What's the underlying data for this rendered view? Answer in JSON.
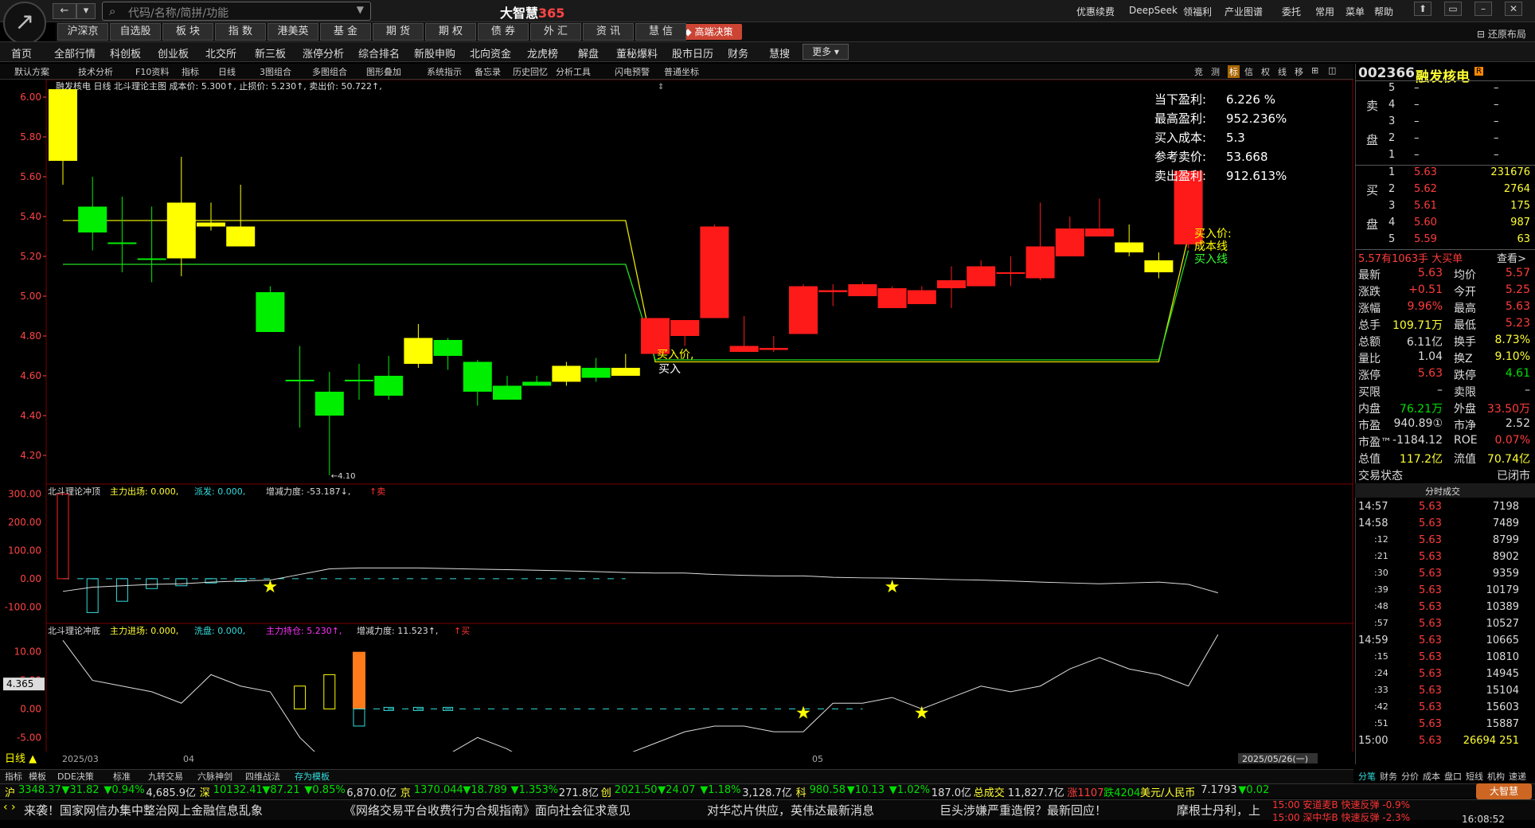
{
  "app": {
    "title": "大智慧",
    "title_suffix": "365"
  },
  "search": {
    "placeholder": "代码/名称/简拼/功能"
  },
  "title_menu": [
    "优惠续费",
    "DeepSeek",
    "领福利",
    "产业图谱",
    "委托",
    "常用",
    "菜单",
    "帮助"
  ],
  "window_buttons": [
    "⬆",
    "▭",
    "–",
    "✕"
  ],
  "restore_layout": "还原布局",
  "market_tabs": [
    "沪深京",
    "自选股",
    "板 块",
    "指 数",
    "港美英",
    "基 金",
    "期 货",
    "期 权",
    "债 券",
    "外 汇",
    "资 讯",
    "慧 信"
  ],
  "premium_button": "高端决策",
  "nav_items": [
    "首页",
    "全部行情",
    "科创板",
    "创业板",
    "北交所",
    "新三板",
    "涨停分析",
    "综合排名",
    "新股申购",
    "北向资金",
    "龙虎榜",
    "解盘",
    "董秘爆料",
    "股市日历",
    "财务",
    "慧搜"
  ],
  "more_button": "更多",
  "toolbar": [
    "默认方案",
    "技术分析",
    "F10资料",
    "指标",
    "日线",
    "3图组合",
    "多图组合",
    "图形叠加",
    "系统指示",
    "备忘录",
    "历史回忆",
    "分析工具",
    "闪电预警",
    "普通坐标"
  ],
  "toolbar_right": [
    "竞",
    "测",
    "标",
    "信",
    "权",
    "线",
    "移",
    "⊞",
    "◫"
  ],
  "main_chart": {
    "info_line": "融发核电 日线 北斗理论主图 成本价: 5.300↑, 止损价: 5.230↑, 卖出价: 50.722↑,",
    "top_label": "6.04",
    "low_label": "4.10",
    "y_ticks": [
      "6.00",
      "5.80",
      "5.60",
      "5.40",
      "5.20",
      "5.00",
      "4.80",
      "4.60",
      "4.40",
      "4.20"
    ],
    "buy_label_1": "买入价,",
    "buy_label_2": "买入",
    "right_labels": [
      "买入价:",
      "成本线",
      "买入线"
    ],
    "stats": [
      {
        "label": "当下盈利:",
        "value": "6.226  %"
      },
      {
        "label": "最高盈利:",
        "value": "952.236%"
      },
      {
        "label": "买入成本:",
        "value": "5.3"
      },
      {
        "label": "参考卖价:",
        "value": "53.668"
      },
      {
        "label": "卖出盈利:",
        "value": "912.613%"
      }
    ]
  },
  "chart_data": {
    "type": "candlestick",
    "ylim": [
      4.1,
      6.1
    ],
    "candles": [
      {
        "o": 6.04,
        "c": 5.68,
        "h": 6.04,
        "l": 5.56,
        "col": "y"
      },
      {
        "o": 5.45,
        "c": 5.32,
        "h": 5.6,
        "l": 5.23,
        "col": "g"
      },
      {
        "o": 5.27,
        "c": 5.27,
        "h": 5.5,
        "l": 5.12,
        "col": "g"
      },
      {
        "o": 5.19,
        "c": 5.19,
        "h": 5.45,
        "l": 5.07,
        "col": "g"
      },
      {
        "o": 5.47,
        "c": 5.19,
        "h": 5.7,
        "l": 5.1,
        "col": "y"
      },
      {
        "o": 5.37,
        "c": 5.35,
        "h": 5.47,
        "l": 5.33,
        "col": "y"
      },
      {
        "o": 5.35,
        "c": 5.25,
        "h": 5.56,
        "l": 5.25,
        "col": "y"
      },
      {
        "o": 5.02,
        "c": 4.82,
        "h": 5.05,
        "l": 4.82,
        "col": "g"
      },
      {
        "o": 4.58,
        "c": 4.58,
        "h": 4.75,
        "l": 4.34,
        "col": "g"
      },
      {
        "o": 4.52,
        "c": 4.4,
        "h": 4.62,
        "l": 4.1,
        "col": "g"
      },
      {
        "o": 4.58,
        "c": 4.58,
        "h": 4.66,
        "l": 4.48,
        "col": "g"
      },
      {
        "o": 4.6,
        "c": 4.5,
        "h": 4.7,
        "l": 4.48,
        "col": "g"
      },
      {
        "o": 4.79,
        "c": 4.66,
        "h": 4.86,
        "l": 4.64,
        "col": "y"
      },
      {
        "o": 4.78,
        "c": 4.7,
        "h": 4.79,
        "l": 4.63,
        "col": "g"
      },
      {
        "o": 4.67,
        "c": 4.52,
        "h": 4.68,
        "l": 4.45,
        "col": "g"
      },
      {
        "o": 4.55,
        "c": 4.48,
        "h": 4.6,
        "l": 4.48,
        "col": "g"
      },
      {
        "o": 4.57,
        "c": 4.55,
        "h": 4.6,
        "l": 4.55,
        "col": "g"
      },
      {
        "o": 4.65,
        "c": 4.57,
        "h": 4.67,
        "l": 4.55,
        "col": "y"
      },
      {
        "o": 4.64,
        "c": 4.59,
        "h": 4.69,
        "l": 4.57,
        "col": "g"
      },
      {
        "o": 4.64,
        "c": 4.6,
        "h": 4.71,
        "l": 4.6,
        "col": "y"
      },
      {
        "o": 4.71,
        "c": 4.89,
        "h": 4.89,
        "l": 4.71,
        "col": "r"
      },
      {
        "o": 4.8,
        "c": 4.88,
        "h": 4.88,
        "l": 4.75,
        "col": "r"
      },
      {
        "o": 4.89,
        "c": 5.35,
        "h": 5.36,
        "l": 4.89,
        "col": "r"
      },
      {
        "o": 4.72,
        "c": 4.75,
        "h": 4.9,
        "l": 4.72,
        "col": "r"
      },
      {
        "o": 4.73,
        "c": 4.74,
        "h": 4.8,
        "l": 4.72,
        "col": "r"
      },
      {
        "o": 4.81,
        "c": 5.05,
        "h": 5.06,
        "l": 4.81,
        "col": "r"
      },
      {
        "o": 5.02,
        "c": 5.03,
        "h": 5.06,
        "l": 4.95,
        "col": "r"
      },
      {
        "o": 5.0,
        "c": 5.06,
        "h": 5.07,
        "l": 5.0,
        "col": "r"
      },
      {
        "o": 4.94,
        "c": 5.04,
        "h": 5.05,
        "l": 4.94,
        "col": "r"
      },
      {
        "o": 4.96,
        "c": 5.03,
        "h": 5.05,
        "l": 4.96,
        "col": "r"
      },
      {
        "o": 5.04,
        "c": 5.08,
        "h": 5.15,
        "l": 4.94,
        "col": "r"
      },
      {
        "o": 5.05,
        "c": 5.15,
        "h": 5.18,
        "l": 5.05,
        "col": "r"
      },
      {
        "o": 5.12,
        "c": 5.12,
        "h": 5.2,
        "l": 5.05,
        "col": "r"
      },
      {
        "o": 5.09,
        "c": 5.25,
        "h": 5.47,
        "l": 5.08,
        "col": "r"
      },
      {
        "o": 5.2,
        "c": 5.34,
        "h": 5.4,
        "l": 5.2,
        "col": "r"
      },
      {
        "o": 5.3,
        "c": 5.34,
        "h": 5.49,
        "l": 5.3,
        "col": "r"
      },
      {
        "o": 5.27,
        "c": 5.22,
        "h": 5.36,
        "l": 5.2,
        "col": "y"
      },
      {
        "o": 5.18,
        "c": 5.12,
        "h": 5.22,
        "l": 5.09,
        "col": "y"
      },
      {
        "o": 5.26,
        "c": 5.63,
        "h": 5.63,
        "l": 5.24,
        "col": "r"
      }
    ],
    "cost_line": [
      5.38,
      5.38,
      5.38,
      5.38,
      5.38,
      5.38,
      5.38,
      5.38,
      5.38,
      5.38,
      5.38,
      5.38,
      5.38,
      5.38,
      5.38,
      5.38,
      5.38,
      5.38,
      5.38,
      5.38,
      4.67,
      4.67,
      4.67,
      4.67,
      4.67,
      4.67,
      4.67,
      4.67,
      4.67,
      4.67,
      4.67,
      4.67,
      4.67,
      4.67,
      4.67,
      4.67,
      4.67,
      4.67,
      5.3
    ],
    "buy_line": [
      5.16,
      5.16,
      5.16,
      5.16,
      5.16,
      5.16,
      5.16,
      5.16,
      5.16,
      5.16,
      5.16,
      5.16,
      5.16,
      5.16,
      5.16,
      5.16,
      5.16,
      5.16,
      5.16,
      5.16,
      4.68,
      4.68,
      4.68,
      4.68,
      4.68,
      4.68,
      4.68,
      4.68,
      4.68,
      4.68,
      4.68,
      4.68,
      4.68,
      4.68,
      4.68,
      4.68,
      4.68,
      4.68,
      5.23
    ]
  },
  "sub1": {
    "title": "北斗理论冲顶",
    "params": [
      {
        "t": "主力出场: 0.000,",
        "c": "yel"
      },
      {
        "t": "派发: 0.000,",
        "c": "cyn"
      },
      {
        "t": "增减力度: -53.187↓,",
        "c": "wht"
      },
      {
        "t": "↑卖",
        "c": "red"
      }
    ],
    "y_ticks": [
      "300.00",
      "200.00",
      "100.00",
      "0.00",
      "-100.00"
    ],
    "ylim": [
      -150,
      330
    ],
    "line": [
      -45,
      -30,
      -25,
      -20,
      -18,
      -12,
      -8,
      -5,
      15,
      35,
      38,
      38,
      38,
      36,
      34,
      32,
      30,
      28,
      25,
      22,
      20,
      20,
      15,
      12,
      10,
      10,
      5,
      3,
      2,
      0,
      -3,
      -5,
      -8,
      -12,
      -15,
      -18,
      -15,
      -12,
      -20,
      -50
    ],
    "bars": [
      {
        "i": 0,
        "v": 300,
        "c": "r"
      },
      {
        "i": 1,
        "v": -120,
        "c": "c"
      },
      {
        "i": 2,
        "v": -80,
        "c": "c"
      },
      {
        "i": 3,
        "v": -35,
        "c": "c"
      },
      {
        "i": 4,
        "v": -25,
        "c": "c"
      },
      {
        "i": 5,
        "v": -15,
        "c": "c"
      },
      {
        "i": 6,
        "v": -10,
        "c": "c"
      }
    ],
    "dash_until": 19,
    "stars": [
      7,
      28
    ]
  },
  "sub2": {
    "title": "北斗理论冲底",
    "params": [
      {
        "t": "主力进场: 0.000,",
        "c": "yel"
      },
      {
        "t": "洗盘: 0.000,",
        "c": "cyn"
      },
      {
        "t": "主力持仓: 5.230↑,",
        "c": "mag"
      },
      {
        "t": "增减力度: 11.523↑,",
        "c": "wht"
      },
      {
        "t": "↑买",
        "c": "red"
      }
    ],
    "y_ticks": [
      "10.00",
      "5.00",
      "0.00",
      "-5.00"
    ],
    "cur_value": "4.365",
    "ylim": [
      -9,
      14
    ],
    "line": [
      12,
      5,
      4,
      3,
      1,
      6,
      4,
      3,
      -5,
      -10,
      -10.5,
      -10,
      -9,
      -8,
      -5,
      -7,
      -10,
      -9.5,
      -9,
      -8,
      -6,
      -4,
      -3,
      -3,
      -4,
      -4,
      1,
      1,
      2,
      0,
      2,
      4,
      3,
      4,
      7,
      9,
      7,
      6,
      4,
      13
    ],
    "hollow_bars": [
      {
        "i": 8,
        "v": 4
      },
      {
        "i": 9,
        "v": 6
      }
    ],
    "orange_bar": {
      "i": 10,
      "v": 10
    },
    "dash_from": 10,
    "dash_until": 27,
    "stars": [
      25,
      29
    ]
  },
  "date_axis": {
    "labels": [
      "2025/03",
      "04",
      "05"
    ],
    "end_date": "2025/05/26(一)",
    "period": "日线"
  },
  "bottom_tabs": [
    "指标",
    "模板",
    "DDE决策",
    "标准",
    "九转交易",
    "六脉神剑",
    "四维战法",
    "存为模板"
  ],
  "right_tabs": [
    "分笔",
    "财务",
    "分价",
    "成本",
    "盘口",
    "短线",
    "机构",
    "速递"
  ],
  "stock": {
    "code": "002366",
    "name": "融发核电",
    "tag": "R"
  },
  "order_book": {
    "sell": [
      {
        "n": "5",
        "p": "–",
        "v": "–"
      },
      {
        "n": "4",
        "p": "–",
        "v": "–"
      },
      {
        "n": "3",
        "p": "–",
        "v": "–"
      },
      {
        "n": "2",
        "p": "–",
        "v": "–"
      },
      {
        "n": "1",
        "p": "–",
        "v": "–"
      }
    ],
    "buy": [
      {
        "n": "1",
        "p": "5.63",
        "v": "231676"
      },
      {
        "n": "2",
        "p": "5.62",
        "v": "2764"
      },
      {
        "n": "3",
        "p": "5.61",
        "v": "175"
      },
      {
        "n": "4",
        "p": "5.60",
        "v": "987"
      },
      {
        "n": "5",
        "p": "5.59",
        "v": "63"
      }
    ],
    "sell_label": [
      "卖",
      "盘"
    ],
    "buy_label": [
      "买",
      "盘"
    ]
  },
  "big_order": {
    "text": "5.57有1063手 大买单",
    "link": "查看>"
  },
  "quote": [
    {
      "l": "最新",
      "v": "5.63",
      "vc": "red",
      "l2": "均价",
      "v2": "5.57",
      "v2c": "red"
    },
    {
      "l": "涨跌",
      "v": "+0.51",
      "vc": "red",
      "l2": "今开",
      "v2": "5.25",
      "v2c": "red"
    },
    {
      "l": "涨幅",
      "v": "9.96%",
      "vc": "red",
      "l2": "最高",
      "v2": "5.63",
      "v2c": "red"
    },
    {
      "l": "总手",
      "v": "109.71万",
      "vc": "yel",
      "l2": "最低",
      "v2": "5.23",
      "v2c": "red"
    },
    {
      "l": "总额",
      "v": "6.11亿",
      "vc": "wht",
      "l2": "换手",
      "v2": "8.73%",
      "v2c": "yel"
    },
    {
      "l": "量比",
      "v": "1.04",
      "vc": "wht",
      "l2": "换Z",
      "v2": "9.10%",
      "v2c": "yel"
    },
    {
      "l": "涨停",
      "v": "5.63",
      "vc": "red",
      "l2": "跌停",
      "v2": "4.61",
      "v2c": "grn"
    },
    {
      "l": "买限",
      "v": "–",
      "vc": "wht",
      "l2": "卖限",
      "v2": "–",
      "v2c": "wht"
    },
    {
      "l": "内盘",
      "v": "76.21万",
      "vc": "grn",
      "l2": "外盘",
      "v2": "33.50万",
      "v2c": "red"
    },
    {
      "l": "市盈",
      "v": "940.89①",
      "vc": "wht",
      "l2": "市净",
      "v2": "2.52",
      "v2c": "wht"
    },
    {
      "l": "市盈™",
      "v": "-1184.12",
      "vc": "wht",
      "l2": "ROE",
      "v2": "0.07%",
      "v2c": "red"
    },
    {
      "l": "总值",
      "v": "117.2亿",
      "vc": "yel",
      "l2": "流值",
      "v2": "70.74亿",
      "v2c": "yel"
    }
  ],
  "trade_status": {
    "l": "交易状态",
    "v": "已闭市"
  },
  "ticks_header": "分时成交",
  "ticks": [
    {
      "t": "14:57",
      "p": "5.63",
      "v": "7198"
    },
    {
      "t": "14:58",
      "p": "5.63",
      "v": "7489"
    },
    {
      "t": ":12",
      "p": "5.63",
      "v": "8799"
    },
    {
      "t": ":21",
      "p": "5.63",
      "v": "8902"
    },
    {
      "t": ":30",
      "p": "5.63",
      "v": "9359"
    },
    {
      "t": ":39",
      "p": "5.63",
      "v": "10179"
    },
    {
      "t": ":48",
      "p": "5.63",
      "v": "10389"
    },
    {
      "t": ":57",
      "p": "5.63",
      "v": "10527"
    },
    {
      "t": "14:59",
      "p": "5.63",
      "v": "10665"
    },
    {
      "t": ":15",
      "p": "5.63",
      "v": "10810"
    },
    {
      "t": ":24",
      "p": "5.63",
      "v": "14945"
    },
    {
      "t": ":33",
      "p": "5.63",
      "v": "15104"
    },
    {
      "t": ":42",
      "p": "5.63",
      "v": "15603"
    },
    {
      "t": ":51",
      "p": "5.63",
      "v": "15887"
    },
    {
      "t": "15:00",
      "p": "5.63",
      "v": "26694 251"
    }
  ],
  "ticker": [
    {
      "t": "沪",
      "c": "yel"
    },
    {
      "t": "3348.37",
      "c": "grn"
    },
    {
      "t": "▼31.82",
      "c": "grn"
    },
    {
      "t": "▼0.94%",
      "c": "grn"
    },
    {
      "t": "4,685.9亿",
      "c": "wht"
    },
    {
      "t": "深",
      "c": "yel"
    },
    {
      "t": "10132.41",
      "c": "grn"
    },
    {
      "t": "▼87.21",
      "c": "grn"
    },
    {
      "t": "▼0.85%",
      "c": "grn"
    },
    {
      "t": "6,870.0亿",
      "c": "wht"
    },
    {
      "t": "京",
      "c": "yel"
    },
    {
      "t": "1370.044",
      "c": "grn"
    },
    {
      "t": "▼18.789",
      "c": "grn"
    },
    {
      "t": "▼1.353%",
      "c": "grn"
    },
    {
      "t": "271.8亿",
      "c": "wht"
    },
    {
      "t": "创",
      "c": "yel"
    },
    {
      "t": "2021.50",
      "c": "grn"
    },
    {
      "t": "▼24.07",
      "c": "grn"
    },
    {
      "t": "▼1.18%",
      "c": "grn"
    },
    {
      "t": "3,128.7亿",
      "c": "wht"
    },
    {
      "t": "科",
      "c": "yel"
    },
    {
      "t": "980.58",
      "c": "grn"
    },
    {
      "t": "▼10.13",
      "c": "grn"
    },
    {
      "t": "▼1.02%",
      "c": "grn"
    },
    {
      "t": "187.0亿",
      "c": "wht"
    },
    {
      "t": "总成交",
      "c": "yel"
    },
    {
      "t": "11,827.7亿",
      "c": "wht"
    },
    {
      "t": "涨1107",
      "c": "red"
    },
    {
      "t": "跌4204",
      "c": "grn"
    },
    {
      "t": "美元/人民币",
      "c": "yel"
    },
    {
      "t": "7.1793",
      "c": "wht"
    },
    {
      "t": "▼0.02",
      "c": "grn"
    }
  ],
  "brand_badge": "大智慧",
  "news": [
    "来袭！国家网信办集中整治网上金融信息乱象",
    "《网络交易平台收费行为合规指南》面向社会征求意见",
    "对华芯片供应，英伟达最新消息",
    "巨头涉嫌严重造假？最新回应！",
    "摩根士丹利，上"
  ],
  "alerts": [
    "15:00 安道麦B 快速反弹 -0.9%",
    "15:00 深中华B 快速反弹 -2.3%"
  ],
  "clock": "16:08:52"
}
